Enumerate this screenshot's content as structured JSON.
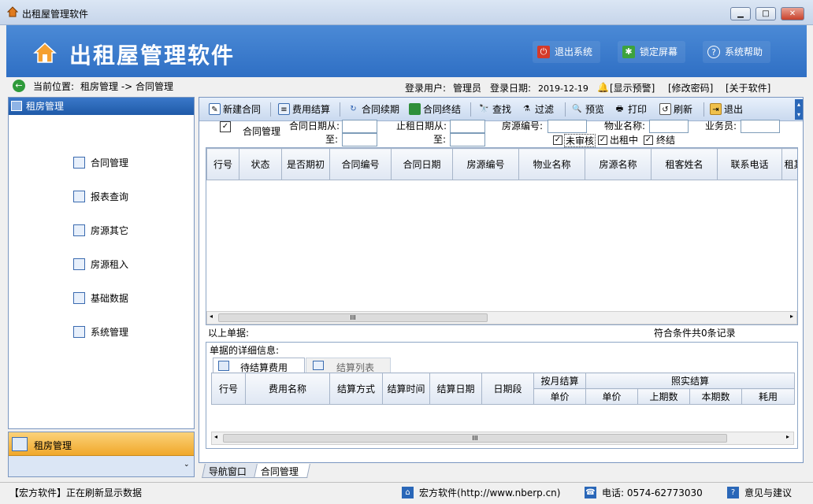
{
  "window": {
    "title": "出租屋管理软件"
  },
  "banner": {
    "title": "出租屋管理软件",
    "buttons": [
      {
        "label": "退出系统",
        "icon": "exit-icon"
      },
      {
        "label": "锁定屏幕",
        "icon": "lock-icon"
      },
      {
        "label": "系统帮助",
        "icon": "help-icon"
      }
    ]
  },
  "location": {
    "label": "当前位置:",
    "path": "租房管理 -> 合同管理",
    "user_label": "登录用户:",
    "user": "管理员",
    "date_label": "登录日期:",
    "date": "2019-12-19",
    "links": [
      "[显示预警]",
      "[修改密码]",
      "[关于软件]"
    ]
  },
  "sidebar": {
    "header": "租房管理",
    "items": [
      {
        "label": "合同管理",
        "icon": "contract-icon"
      },
      {
        "label": "报表查询",
        "icon": "report-icon"
      },
      {
        "label": "房源其它",
        "icon": "house-other-icon"
      },
      {
        "label": "房源租入",
        "icon": "house-rentin-icon"
      },
      {
        "label": "基础数据",
        "icon": "base-data-icon"
      },
      {
        "label": "系统管理",
        "icon": "system-icon"
      }
    ],
    "bottom_group": "租房管理"
  },
  "toolbar": {
    "buttons": [
      {
        "label": "新建合同",
        "icon": "new-contract-icon"
      },
      {
        "label": "费用结算",
        "icon": "fee-settle-icon"
      },
      {
        "label": "合同续期",
        "icon": "renew-icon"
      },
      {
        "label": "合同终结",
        "icon": "terminate-icon"
      },
      {
        "label": "查找",
        "icon": "find-icon"
      },
      {
        "label": "过滤",
        "icon": "filter-icon"
      },
      {
        "label": "预览",
        "icon": "preview-icon"
      },
      {
        "label": "打印",
        "icon": "print-icon"
      },
      {
        "label": "刷新",
        "icon": "refresh-icon"
      },
      {
        "label": "退出",
        "icon": "exit-folder-icon"
      }
    ]
  },
  "filter": {
    "section_title": "合同管理",
    "contract_date_from": "合同日期从:",
    "contract_date_to": "至:",
    "end_date_from": "止租日期从:",
    "end_date_to": "至:",
    "house_no": "房源编号:",
    "property_name": "物业名称:",
    "salesman": "业务员:",
    "checks": [
      {
        "label": "未审核",
        "checked": true
      },
      {
        "label": "出租中",
        "checked": true
      },
      {
        "label": "终结",
        "checked": true
      }
    ]
  },
  "contract_table": {
    "columns": [
      "行号",
      "状态",
      "是否期初",
      "合同编号",
      "合同日期",
      "房源编号",
      "物业名称",
      "房源名称",
      "租客姓名",
      "联系电话",
      "租其"
    ]
  },
  "summary": {
    "label": "以上单据:",
    "count_text": "符合条件共0条记录"
  },
  "detail": {
    "title": "单据的详细信息:",
    "tabs": [
      "待结算费用",
      "结算列表"
    ],
    "columns": [
      "行号",
      "费用名称",
      "结算方式",
      "结算时间",
      "结算日期",
      "日期段"
    ],
    "group1": "按月结算",
    "group1_sub": [
      "单价"
    ],
    "group2": "照实结算",
    "group2_sub": [
      "单价",
      "上期数",
      "本期数",
      "耗用"
    ]
  },
  "bottom_tabs": [
    "导航窗口",
    "合同管理"
  ],
  "statusbar": {
    "message": "【宏方软件】正在刷新显示数据",
    "company": "宏方软件(http://www.nberp.cn)",
    "phone": "电话: 0574-62773030",
    "feedback": "意见与建议"
  },
  "scroll_glyph": "III",
  "colors": {
    "banner": "#3a7ccf",
    "sidebar_header": "#2a67b8",
    "bottom_group": "#f3b63d"
  }
}
